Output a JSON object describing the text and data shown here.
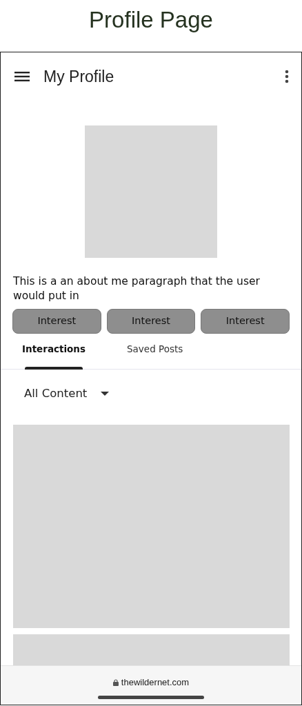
{
  "page_title": "Profile Page",
  "app_bar": {
    "title": "My Profile"
  },
  "about": "This is a an about me paragraph that the user would put in",
  "interests": [
    "Interest",
    "Interest",
    "Interest"
  ],
  "tabs": [
    {
      "label": "Interactions",
      "selected": true
    },
    {
      "label": "Saved Posts",
      "selected": false
    }
  ],
  "filter": {
    "value": "All Content"
  },
  "browser_bar": {
    "url": "thewildernet.com"
  }
}
